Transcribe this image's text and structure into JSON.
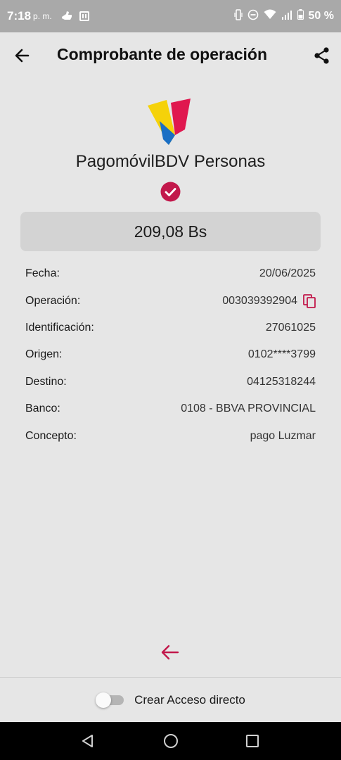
{
  "status_bar": {
    "time": "7:18",
    "time_suffix": "p. m.",
    "battery_percent": "50 %",
    "icons": [
      "hand-icon",
      "note-icon",
      "vibrate-icon",
      "do-not-disturb-icon",
      "wifi-icon",
      "signal-icon",
      "battery-icon"
    ]
  },
  "header": {
    "title": "Comprobante de operación",
    "back_icon": "arrow-left-icon",
    "share_icon": "share-icon"
  },
  "receipt": {
    "service_name": "PagomóvilBDV Personas",
    "status_icon": "check-circle-icon",
    "amount": "209,08 Bs",
    "details": [
      {
        "label": "Fecha:",
        "value": "20/06/2025"
      },
      {
        "label": "Operación:",
        "value": "003039392904"
      },
      {
        "label": "Identificación:",
        "value": "27061025"
      },
      {
        "label": "Origen:",
        "value": "0102****3799"
      },
      {
        "label": "Destino:",
        "value": "04125318244"
      },
      {
        "label": "Banco:",
        "value": "0108 - BBVA PROVINCIAL"
      },
      {
        "label": "Concepto:",
        "value": "pago Luzmar"
      }
    ]
  },
  "footer": {
    "shortcut_label": "Crear Acceso directo",
    "shortcut_enabled": false
  },
  "colors": {
    "accent": "#c2184b",
    "background": "#e6e6e6",
    "amount_box": "#d3d3d3",
    "status_bar": "#a9a9a9"
  }
}
